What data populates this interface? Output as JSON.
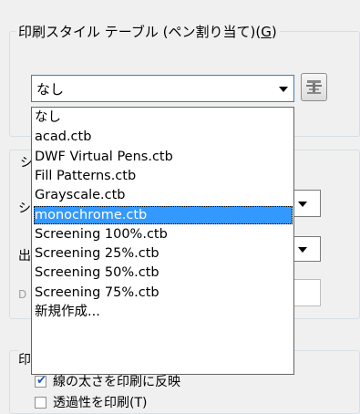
{
  "plot_style_group": {
    "title": "印刷スタイル テーブル (ペン割り当て)(G)",
    "title_prefix": "印刷スタイル テーブル (ペン割り当て)(",
    "title_mnemonic": "G",
    "title_suffix": ")",
    "combo_value": "なし",
    "dropdown_options": [
      "なし",
      "acad.ctb",
      "DWF Virtual Pens.ctb",
      "Fill Patterns.ctb",
      "Grayscale.ctb",
      "monochrome.ctb",
      "Screening 100%.ctb",
      "Screening 25%.ctb",
      "Screening 50%.ctb",
      "Screening 75%.ctb",
      "新規作成..."
    ],
    "selected_index": 5
  },
  "partial_labels": {
    "group2_fragment": "シ",
    "row1_fragment": "シ",
    "row2_fragment": "出",
    "row3_fragment": "D",
    "group3_fragment": "印"
  },
  "plot_options": {
    "lineweight_label": "線の太さを印刷に反映",
    "lineweight_checked": true,
    "transparency_label": "透過性を印刷(T)",
    "transparency_checked": false
  }
}
